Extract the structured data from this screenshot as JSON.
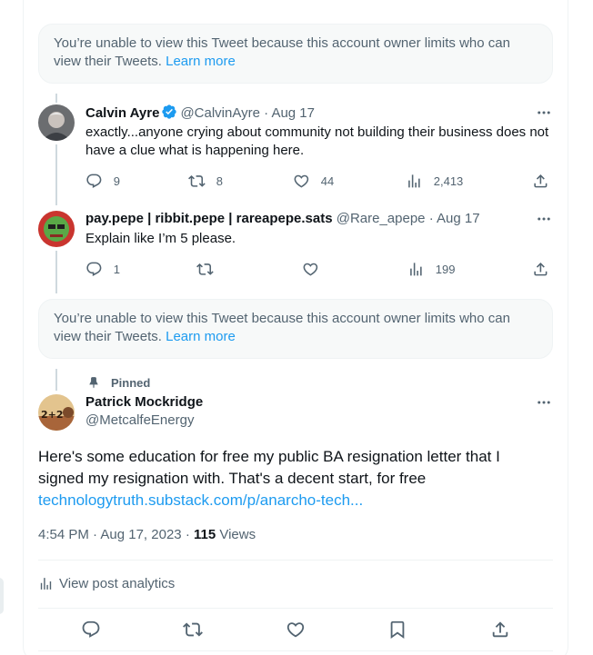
{
  "notices": [
    {
      "text": "You’re unable to view this Tweet because this account owner limits who can view their Tweets.",
      "link": "Learn more"
    },
    {
      "text": "You’re unable to view this Tweet because this account owner limits who can view their Tweets.",
      "link": "Learn more"
    }
  ],
  "replies": [
    {
      "name": "Calvin Ayre",
      "verified": true,
      "handle": "@CalvinAyre",
      "sep": "·",
      "date": "Aug 17",
      "text": "exactly...anyone crying about community not building their business does not have a clue what is happening here.",
      "replies": "9",
      "reposts": "8",
      "likes": "44",
      "views": "2,413"
    },
    {
      "name": "pay.pepe | ribbit.pepe | rareapepe.sats",
      "verified": false,
      "handle": "@Rare_apepe",
      "sep": "·",
      "date": "Aug 17",
      "text": "Explain like I’m 5 please.",
      "replies": "1",
      "reposts": "",
      "likes": "",
      "views": "199"
    }
  ],
  "main_post": {
    "pinned_label": "Pinned",
    "name": "Patrick Mockridge",
    "handle": "@MetcalfeEnergy",
    "text": "Here's some education for free my public BA resignation letter that I signed my resignation with. That's a decent start, for free",
    "link": "technologytruth.substack.com/p/anarcho-tech...",
    "time": "4:54 PM",
    "sep": "·",
    "date": "Aug 17, 2023",
    "views_count": "115",
    "views_label": "Views",
    "analytics_label": "View post analytics"
  },
  "icons": {
    "reply": "reply-icon",
    "repost": "repost-icon",
    "like": "like-icon",
    "views": "views-icon",
    "share": "share-icon",
    "bookmark": "bookmark-icon",
    "more": "more-icon",
    "pin": "pin-icon",
    "verified": "verified-badge-icon"
  },
  "colors": {
    "accent": "#1d9bf0",
    "secondary_text": "#536471",
    "primary_text": "#0f1419",
    "notice_bg": "#f7f9f9"
  }
}
